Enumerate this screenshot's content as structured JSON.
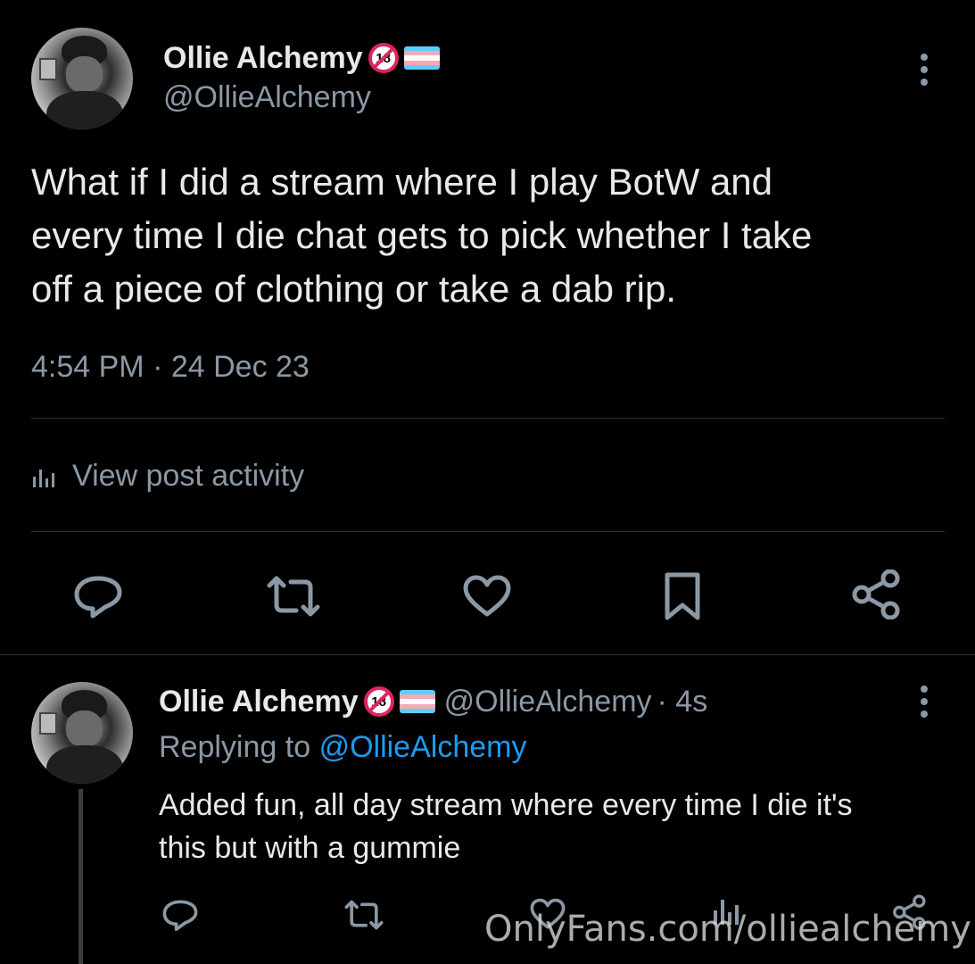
{
  "main_post": {
    "author_name": "Ollie Alchemy",
    "author_handle": "@OllieAlchemy",
    "text_line1": "What if I did a stream where I play BotW and",
    "text_line2": "every time I die chat gets to pick whether I take",
    "text_line3": "off a piece of clothing or take a dab rip.",
    "timestamp": "4:54 PM · 24 Dec 23",
    "activity_label": "View post activity",
    "badge_text": "18"
  },
  "reply": {
    "author_name": "Ollie Alchemy",
    "author_handle": "@OllieAlchemy",
    "time_ago": "· 4s",
    "replying_prefix": "Replying to",
    "replying_handle": "@OllieAlchemy",
    "text_line1": "Added fun, all day stream where every time I die it's",
    "text_line2": "this but with a gummie",
    "badge_text": "18"
  },
  "watermark": "OnlyFans.com/olliealchemy",
  "colors": {
    "background": "#000000",
    "primary_text": "#e7e9ea",
    "secondary_text": "#8b98a5",
    "link": "#1d9bf0",
    "divider": "#2f3336",
    "trans_flag": [
      "#5bcefa",
      "#f5a9b8",
      "#ffffff",
      "#f5a9b8",
      "#5bcefa"
    ]
  },
  "icons": [
    "more-icon",
    "reply-icon",
    "repost-icon",
    "like-icon",
    "bookmark-icon",
    "share-icon",
    "analytics-icon"
  ]
}
